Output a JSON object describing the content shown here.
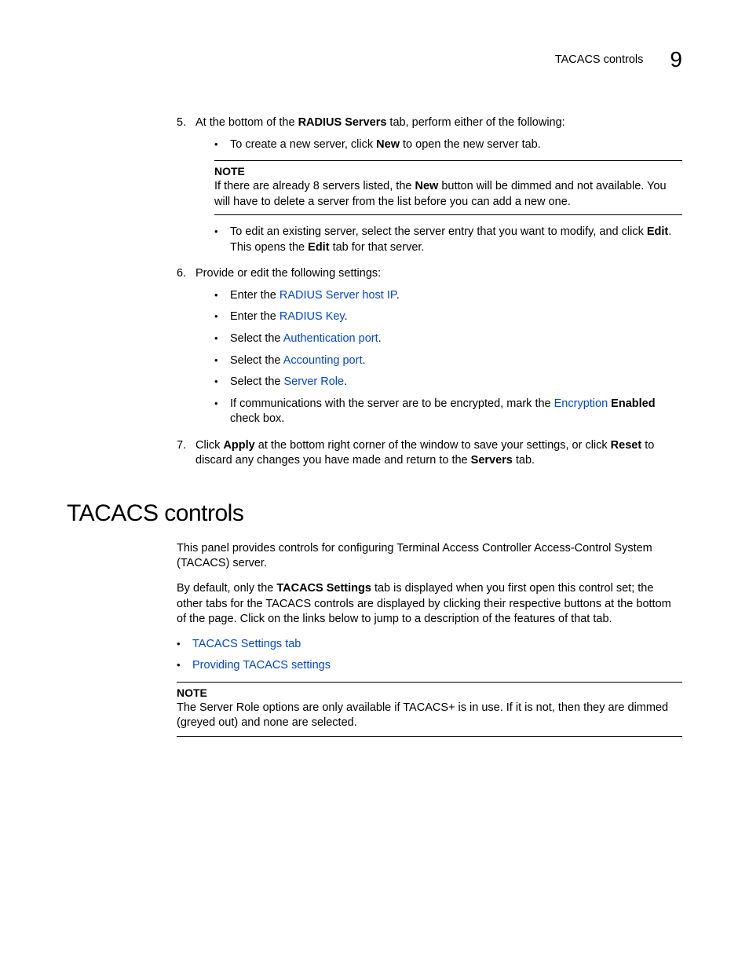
{
  "header": {
    "title": "TACACS controls",
    "chapter_number": "9"
  },
  "steps": {
    "s5": {
      "num": "5.",
      "text_pre": "At the bottom of the ",
      "bold1": "RADIUS Servers",
      "text_post": " tab, perform either of the following:",
      "bullet1_pre": "To create a new server, click ",
      "bullet1_bold": "New",
      "bullet1_post": " to open the new server tab.",
      "note_label": "NOTE",
      "note_pre": "If there are already 8 servers listed, the ",
      "note_bold": "New",
      "note_post": " button will be dimmed and not available. You will have to delete a server from the list before you can add a new one.",
      "bullet2_pre": "To edit an existing server, select the server entry that you want to modify, and click ",
      "bullet2_bold1": "Edit",
      "bullet2_mid": ". This opens the ",
      "bullet2_bold2": "Edit",
      "bullet2_post": " tab for that server."
    },
    "s6": {
      "num": "6.",
      "text": "Provide or edit the following settings:",
      "b1_pre": "Enter the ",
      "b1_link": "RADIUS Server host IP",
      "b1_post": ".",
      "b2_pre": "Enter the ",
      "b2_link": "RADIUS Key",
      "b2_post": ".",
      "b3_pre": "Select the ",
      "b3_link": "Authentication port",
      "b3_post": ".",
      "b4_pre": "Select the ",
      "b4_link": "Accounting port",
      "b4_post": ".",
      "b5_pre": "Select the ",
      "b5_link": "Server Role",
      "b5_post": ".",
      "b6_pre": "If communications with the server are to be encrypted, mark the ",
      "b6_link": "Encryption",
      "b6_bold": " Enabled",
      "b6_post": " check box."
    },
    "s7": {
      "num": "7.",
      "pre": "Click ",
      "bold1": "Apply",
      "mid1": " at the bottom right corner of the window to save your settings, or click ",
      "bold2": "Reset",
      "mid2": " to discard any changes you have made and return to the ",
      "bold3": "Servers",
      "post": " tab."
    }
  },
  "section": {
    "title": "TACACS controls",
    "p1": "This panel provides controls for configuring Terminal Access Controller Access-Control System (TACACS) server.",
    "p2_pre": "By default, only the ",
    "p2_bold": "TACACS Settings",
    "p2_post": " tab is displayed when you first open this control set; the other tabs for the TACACS controls are displayed by clicking their respective buttons at the bottom of the page. Click on the links below to jump to a description of the features of that tab.",
    "link1": "TACACS Settings tab",
    "link2": "Providing TACACS settings",
    "note_label": "NOTE",
    "note_text": "The Server Role options are only available if TACACS+ is in use. If it is not, then they are dimmed (greyed out) and none are selected."
  }
}
